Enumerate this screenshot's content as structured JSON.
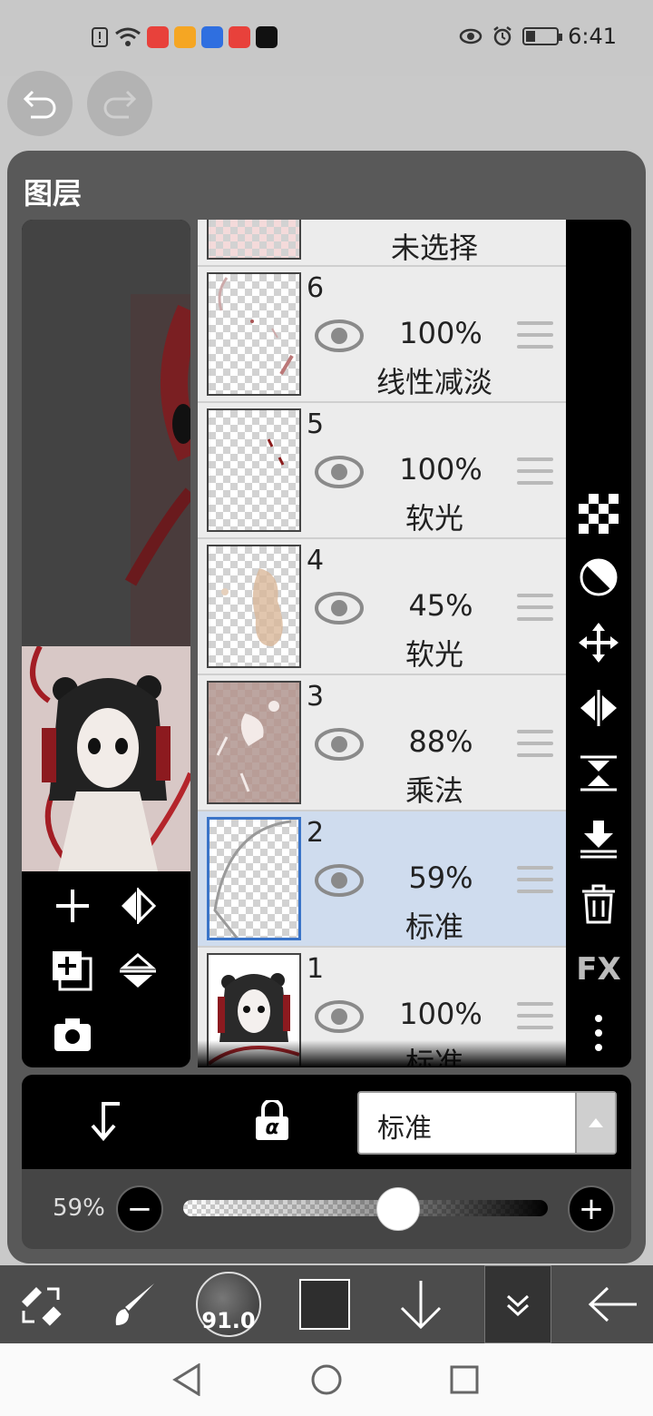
{
  "status": {
    "time": "6:41",
    "icons": [
      "alert-icon",
      "wifi-icon",
      "huawei-app-icon",
      "orange-app-icon",
      "baidu-app-icon",
      "huawei-app-icon",
      "tiktok-app-icon"
    ],
    "right_icons": [
      "eye-comfort-icon",
      "alarm-icon",
      "battery-icon"
    ]
  },
  "app": {
    "panel_title": "图层",
    "top_buttons": [
      "undo-icon",
      "redo-icon"
    ]
  },
  "layers": {
    "top_row_label": "未选择",
    "items": [
      {
        "number": "6",
        "opacity": "100%",
        "mode": "线性减淡",
        "selected": false
      },
      {
        "number": "5",
        "opacity": "100%",
        "mode": "软光",
        "selected": false
      },
      {
        "number": "4",
        "opacity": "45%",
        "mode": "软光",
        "selected": false
      },
      {
        "number": "3",
        "opacity": "88%",
        "mode": "乘法",
        "selected": false
      },
      {
        "number": "2",
        "opacity": "59%",
        "mode": "标准",
        "selected": true
      },
      {
        "number": "1",
        "opacity": "100%",
        "mode": "标准",
        "selected": false
      }
    ]
  },
  "side_tools": [
    "transparency-icon",
    "invert-icon",
    "move-icon",
    "flip-horizontal-icon",
    "flip-vertical-icon",
    "merge-down-icon",
    "delete-icon",
    "fx-icon",
    "more-icon"
  ],
  "side_tools_fx_label": "FX",
  "preview_tools": [
    "add-layer-icon",
    "flip-horizontal-icon",
    "copy-layer-icon",
    "flip-vertical-icon",
    "camera-icon"
  ],
  "blend": {
    "clip_icon": "clip-arrow-icon",
    "alpha_lock_icon": "alpha-lock-icon",
    "alpha_glyph": "α",
    "current_mode": "标准"
  },
  "opacity": {
    "label": "59%",
    "value": 0.59,
    "minus": "−",
    "plus": "+"
  },
  "toolbar": {
    "brush_size": "91.0",
    "color": "#2e2e2e",
    "tools": [
      "transform-select-icon",
      "brush-icon",
      "brush-size-icon",
      "color-swatch",
      "down-arrow-icon",
      "layer-panel-icon",
      "back-arrow-icon"
    ]
  },
  "colors": {
    "selected_row": "#cfdcee",
    "accent_border": "#3a74c8"
  }
}
